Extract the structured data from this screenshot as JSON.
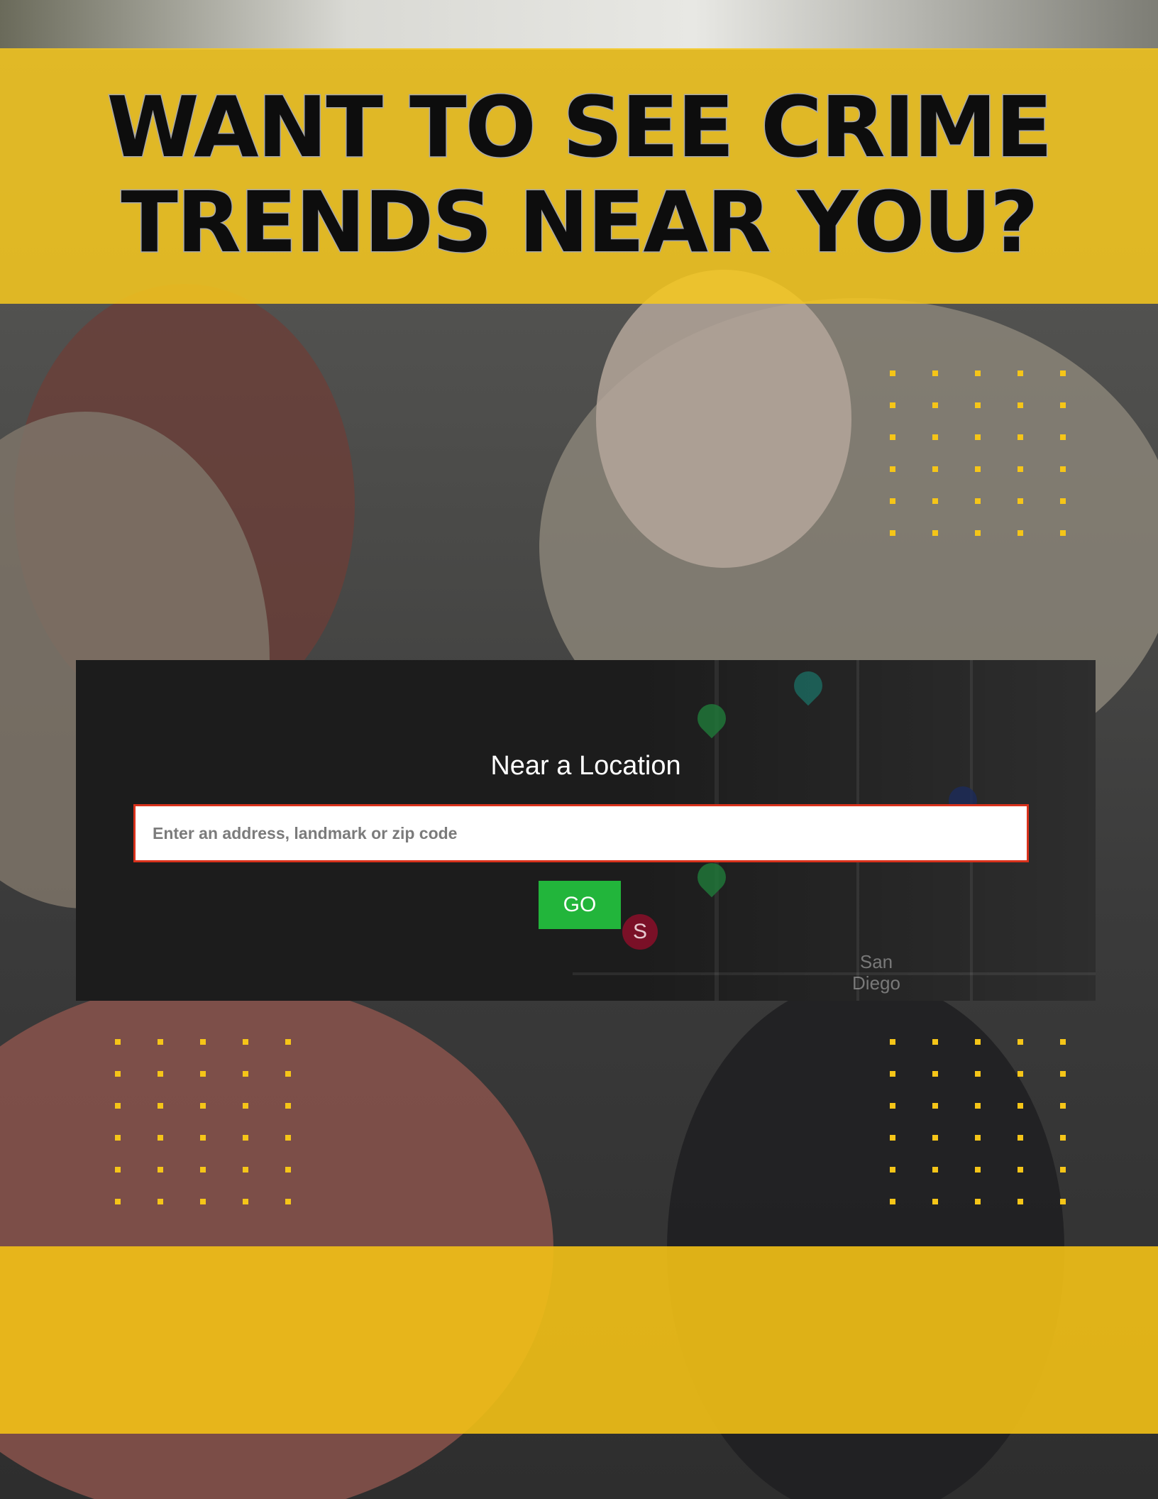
{
  "headline": {
    "line1": "WANT TO SEE CRIME",
    "line2": "TRENDS NEAR YOU?"
  },
  "search_panel": {
    "title": "Near a Location",
    "input_placeholder": "Enter an address, landmark or zip code",
    "input_value": "",
    "go_label": "GO"
  },
  "map": {
    "pin_letter": "S",
    "city_label_line1": "San",
    "city_label_line2": "Diego"
  },
  "colors": {
    "brand_yellow": "#f7c81e",
    "go_green": "#22b53b",
    "input_border_red": "#d9321c",
    "panel_dark": "#1c1c1c"
  }
}
